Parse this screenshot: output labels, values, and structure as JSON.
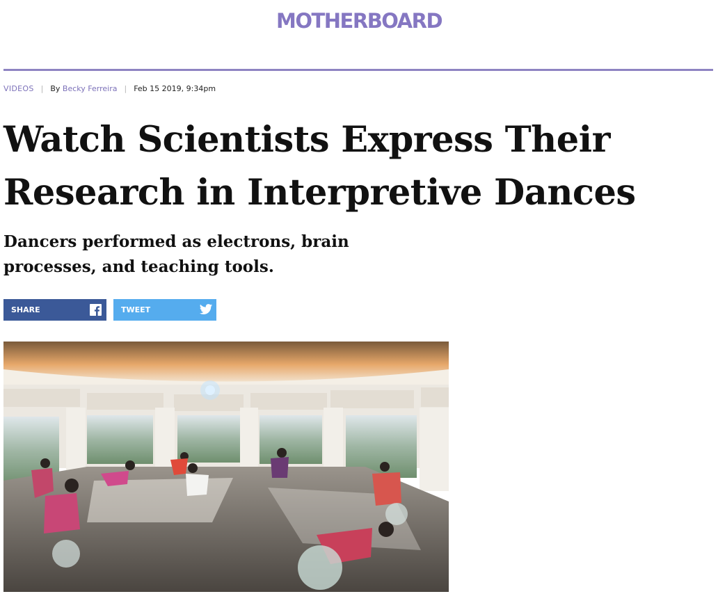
{
  "site": {
    "logo": "MOTHERBOARD"
  },
  "colors": {
    "brand": "#8577c2",
    "facebook": "#3b5998",
    "twitter": "#55acee"
  },
  "meta": {
    "category": "VIDEOS",
    "separator": "|",
    "by_prefix": "By",
    "author": "Becky Ferreira",
    "date": "Feb 15 2019, 9:34pm"
  },
  "article": {
    "headline": "Watch Scientists Express Their Research in Interpretive Dances",
    "dek": "Dancers performed as electrons, brain processes, and teaching tools."
  },
  "share": {
    "facebook_label": "SHARE",
    "facebook_icon": "facebook-icon",
    "twitter_label": "TWEET",
    "twitter_icon": "twitter-bird-icon"
  },
  "hero_image": {
    "subject": "dancers with exercise balls in a round studio with large windows"
  }
}
